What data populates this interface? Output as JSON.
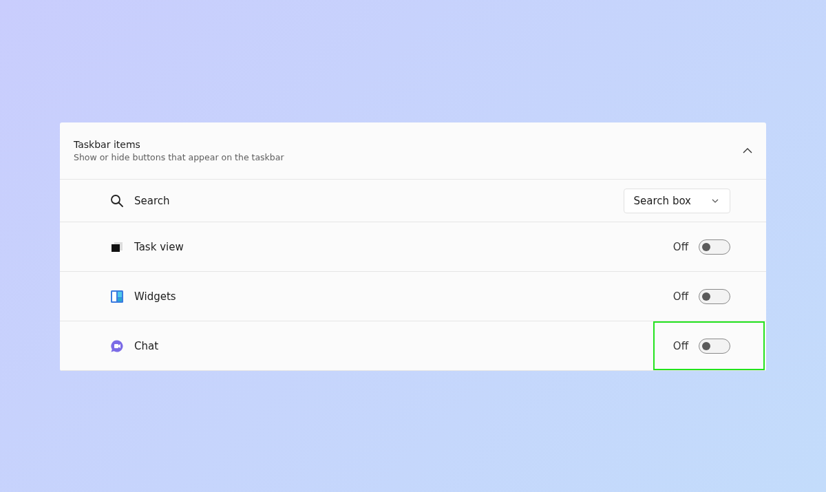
{
  "section": {
    "title": "Taskbar items",
    "subtitle": "Show or hide buttons that appear on the taskbar",
    "expanded": true
  },
  "items": [
    {
      "kind": "dropdown",
      "label": "Search",
      "value": "Search box",
      "highlighted": false
    },
    {
      "kind": "toggle",
      "label": "Task view",
      "state": "Off",
      "on": false,
      "highlighted": false
    },
    {
      "kind": "toggle",
      "label": "Widgets",
      "state": "Off",
      "on": false,
      "highlighted": false
    },
    {
      "kind": "toggle",
      "label": "Chat",
      "state": "Off",
      "on": false,
      "highlighted": true
    }
  ]
}
